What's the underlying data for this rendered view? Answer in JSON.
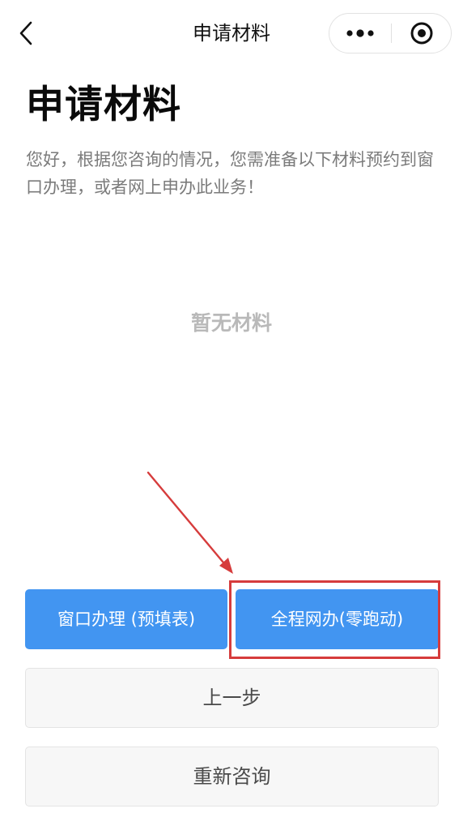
{
  "navbar": {
    "title": "申请材料"
  },
  "header": {
    "title": "申请材料",
    "intro": "您好，根据您咨询的情况，您需准备以下材料预约到窗口办理，或者网上申办此业务！"
  },
  "materials": {
    "empty_text": "暂无材料",
    "items": []
  },
  "actions": {
    "window_label": "窗口办理 (预填表)",
    "online_label": "全程网办(零跑动)",
    "prev_label": "上一步",
    "restart_label": "重新咨询"
  },
  "icons": {
    "back": "chevron-left-icon",
    "more": "more-dots-icon",
    "close": "target-circle-icon"
  },
  "colors": {
    "primary_button": "#4295f1",
    "annotation_red": "#d63c3c",
    "muted_text": "#7b7b7b",
    "empty_text": "#b9b9b9",
    "secondary_button_bg": "#f7f7f7"
  }
}
